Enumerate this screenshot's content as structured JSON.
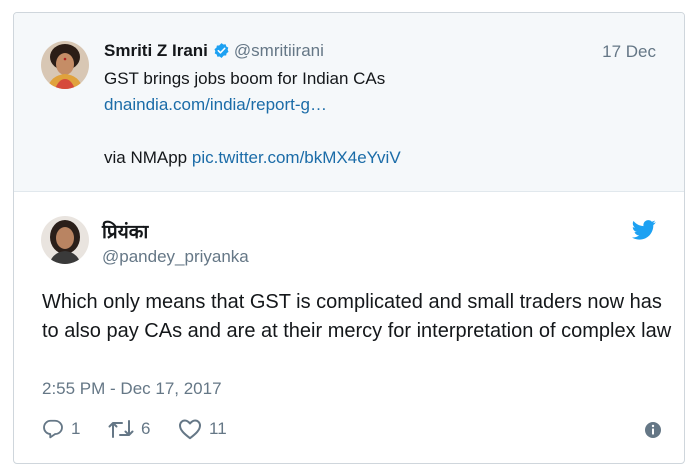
{
  "quoted_tweet": {
    "name": "Smriti Z Irani",
    "handle": "@smritiirani",
    "date": "17 Dec",
    "text": "GST brings jobs boom for Indian CAs",
    "link": "dnaindia.com/india/report-g…",
    "via_prefix": "via NMApp ",
    "pic_link": "pic.twitter.com/bkMX4eYviV",
    "avatar_icon": "user-avatar-photo",
    "verified_icon": "verified-badge-icon",
    "background": "#f5f8fa"
  },
  "reply_tweet": {
    "name": "प्रियंका",
    "handle": "@pandey_priyanka",
    "text": "Which only means that GST is complicated and small traders now has to also pay CAs and are at their mercy for interpretation of complex law",
    "timestamp": "2:55 PM - Dec 17, 2017",
    "avatar_icon": "user-avatar-photo",
    "brand_icon": "twitter-bird-icon",
    "brand_color": "#1da1f2"
  },
  "actions": {
    "replies": "1",
    "retweets": "6",
    "likes": "11",
    "icons": [
      "reply-icon",
      "retweet-icon",
      "heart-icon",
      "info-icon"
    ]
  }
}
